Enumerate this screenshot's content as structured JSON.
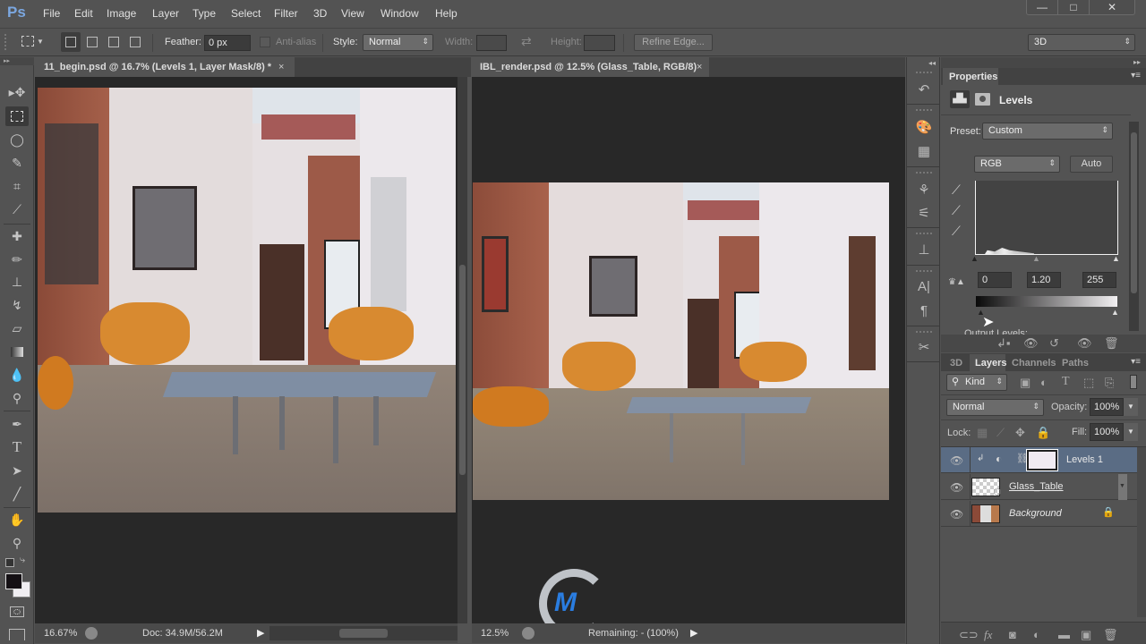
{
  "app": {
    "logo": "Ps"
  },
  "menu": [
    "File",
    "Edit",
    "Image",
    "Layer",
    "Type",
    "Select",
    "Filter",
    "3D",
    "View",
    "Window",
    "Help"
  ],
  "window_controls": {
    "minimize": "—",
    "maximize": "□",
    "close": "✕"
  },
  "options": {
    "feather_label": "Feather:",
    "feather_value": "0 px",
    "antialias_label": "Anti-alias",
    "style_label": "Style:",
    "style_value": "Normal",
    "width_label": "Width:",
    "height_label": "Height:",
    "refine_edge": "Refine Edge...",
    "workspace": "3D"
  },
  "documents": [
    {
      "title": "11_begin.psd @ 16.7% (Levels 1, Layer Mask/8) *",
      "close": "×",
      "zoom": "16.67%",
      "status": "Doc: 34.9M/56.2M"
    },
    {
      "title": "IBL_render.psd @ 12.5% (Glass_Table, RGB/8)",
      "close": "×",
      "zoom": "12.5%",
      "status": "Remaining: - (100%)"
    }
  ],
  "tools": [
    "move",
    "rectangular-marquee",
    "lasso",
    "quick-selection",
    "crop",
    "eyedropper",
    "spot-healing",
    "brush",
    "clone-stamp",
    "history-brush",
    "eraser",
    "gradient",
    "blur",
    "dodge",
    "pen",
    "type",
    "path-selection",
    "line",
    "hand",
    "zoom"
  ],
  "properties": {
    "tab": "Properties",
    "title": "Levels",
    "preset_label": "Preset:",
    "preset_value": "Custom",
    "channel": "RGB",
    "auto": "Auto",
    "input_black": "0",
    "input_gamma": "1.20",
    "input_white": "255",
    "output_label": "Output Levels:"
  },
  "layers_panel": {
    "tabs": [
      "3D",
      "Layers",
      "Channels",
      "Paths"
    ],
    "active_tab": "Layers",
    "filter": "Kind",
    "blend_mode": "Normal",
    "opacity_label": "Opacity:",
    "opacity": "100%",
    "lock_label": "Lock:",
    "fill_label": "Fill:",
    "fill": "100%",
    "layers": [
      {
        "name": "Levels 1",
        "visible": true,
        "selected": true
      },
      {
        "name": "Glass_Table",
        "visible": true,
        "selected": false
      },
      {
        "name": "Background",
        "visible": true,
        "selected": false,
        "locked": true
      }
    ]
  },
  "colors": {
    "accent_selected": "#5a6c84",
    "panel": "#535353",
    "canvas_bg": "#282828"
  }
}
